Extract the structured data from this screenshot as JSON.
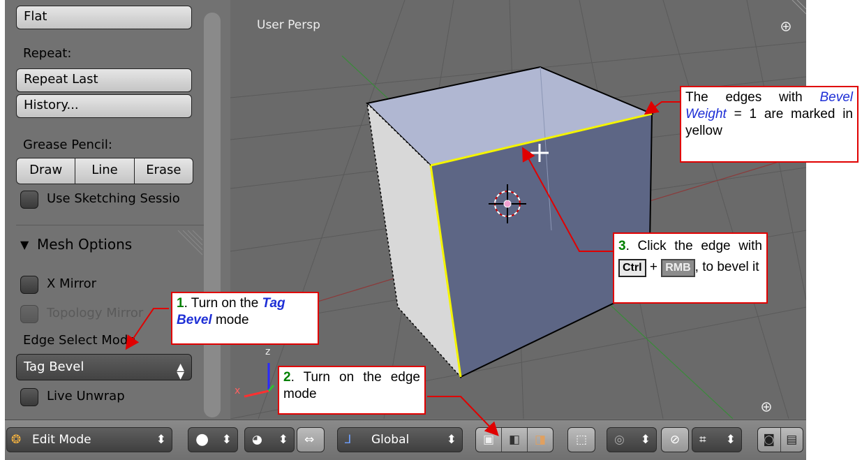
{
  "panel": {
    "flat_label": "Flat",
    "repeat_heading": "Repeat:",
    "repeat_last_label": "Repeat Last",
    "history_label": "History...",
    "grease_heading": "Grease Pencil:",
    "grease_buttons": [
      "Draw",
      "Line",
      "Erase"
    ],
    "use_sketching_label": "Use Sketching Sessio",
    "mesh_options_label": "Mesh Options",
    "x_mirror_label": "X Mirror",
    "topology_mirror_label": "Topology Mirror",
    "edge_select_mode_label": "Edge Select Mode",
    "edge_select_mode_value": "Tag Bevel",
    "live_unwrap_label": "Live Unwrap"
  },
  "viewport": {
    "view_label": "User Persp",
    "axis_x": "x",
    "axis_z": "z"
  },
  "header": {
    "mode_label": "Edit Mode",
    "orientation_label": "Global"
  },
  "callouts": {
    "c1_num": "1",
    "c1_a": ". Turn on the ",
    "c1_term1": "Tag",
    "c1_term2": "Bevel",
    "c1_b": " mode",
    "c2_num": "2",
    "c2_a": ". Turn on the edge mode",
    "c3_num": "3",
    "c3_a": ". Click the edge with ",
    "c3_key1": "Ctrl",
    "c3_plus": " + ",
    "c3_key2": "RMB",
    "c3_b": ", to bevel it",
    "c4_a": "The edges with ",
    "c4_term1": "Bevel",
    "c4_term2": "Weight",
    "c4_b": " = 1 are marked in yellow"
  },
  "colors": {
    "panel_bg": "#727272",
    "viewport_bg": "#6a6a6a",
    "callout_border": "#e00000",
    "number_green": "#008000",
    "term_blue": "#1e2fd6",
    "selected_edge": "#f4f400"
  }
}
